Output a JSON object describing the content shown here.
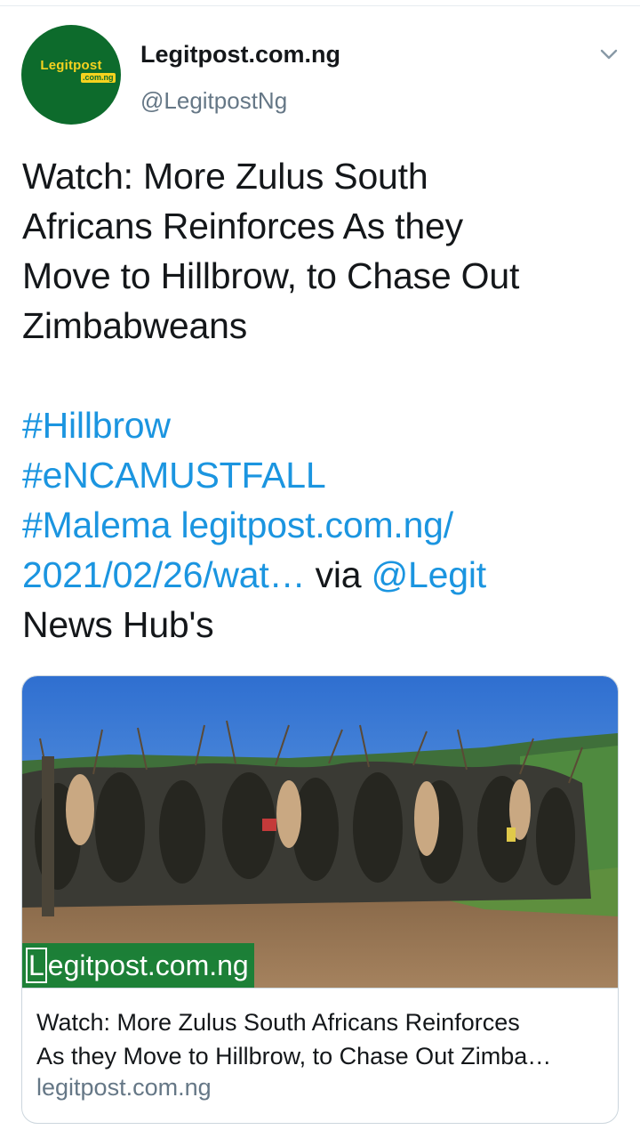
{
  "account": {
    "display_name": "Legitpost.com.ng",
    "handle": "@LegitpostNg",
    "avatar_logo_main": "Legitpost",
    "avatar_logo_sub": ".com.ng"
  },
  "menu_icon": "chevron-down-icon",
  "tweet": {
    "lines": [
      "Watch: More Zulus South",
      "Africans Reinforces As they",
      "Move to Hillbrow, to Chase Out",
      "Zimbabweans"
    ],
    "hashtag_1": "#Hillbrow",
    "hashtag_2": "#eNCAMUSTFALL",
    "hashtag_3": "#Malema",
    "link_part_1": "legitpost.com.ng/",
    "link_part_2": "2021/02/26/wat…",
    "via_text": " via ",
    "mention": "@Legit",
    "trailing_text": "News Hub's"
  },
  "card": {
    "watermark_first": "L",
    "watermark_rest": "egitpost.com.ng",
    "title_line_1": "Watch: More Zulus South Africans Reinforces",
    "title_line_2": "As they Move to Hillbrow, to Chase Out Zimba…",
    "domain": "legitpost.com.ng"
  },
  "colors": {
    "link": "#1b95e0",
    "secondary_text": "#657786",
    "logo_green": "#0d6b2c",
    "logo_yellow": "#f5d21f"
  }
}
